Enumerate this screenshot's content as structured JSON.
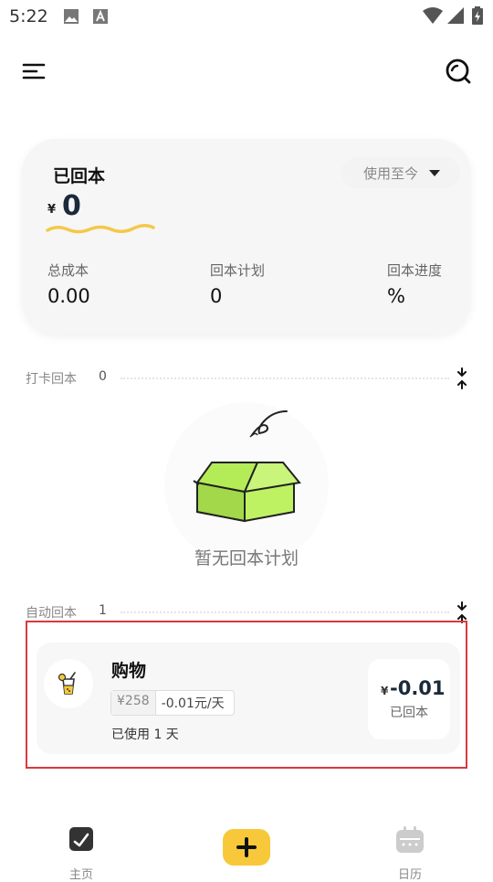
{
  "status_bar": {
    "time": "5:22"
  },
  "summary": {
    "title": "已回本",
    "range_select": "使用至今",
    "currency": "¥",
    "recovered_value": "0",
    "metrics": [
      {
        "label": "总成本",
        "value": "0.00"
      },
      {
        "label": "回本计划",
        "value": "0"
      },
      {
        "label": "回本进度",
        "value": "%"
      }
    ]
  },
  "checkin_section": {
    "label": "打卡回本",
    "count": "0"
  },
  "empty_state": {
    "text": "暂无回本计划"
  },
  "auto_section": {
    "label": "自动回本",
    "count": "1"
  },
  "plan": {
    "name": "购物",
    "cost_tag": "¥258",
    "daily_tag": "-0.01元/天",
    "used_days": "已使用 1 天",
    "currency": "¥",
    "amount": "-0.01",
    "amount_label": "已回本"
  },
  "nav": {
    "home": "主页",
    "calendar": "日历"
  },
  "colors": {
    "accent_yellow": "#f7c93a",
    "highlight_red": "#d9393e",
    "box_green": "#a8e063"
  }
}
